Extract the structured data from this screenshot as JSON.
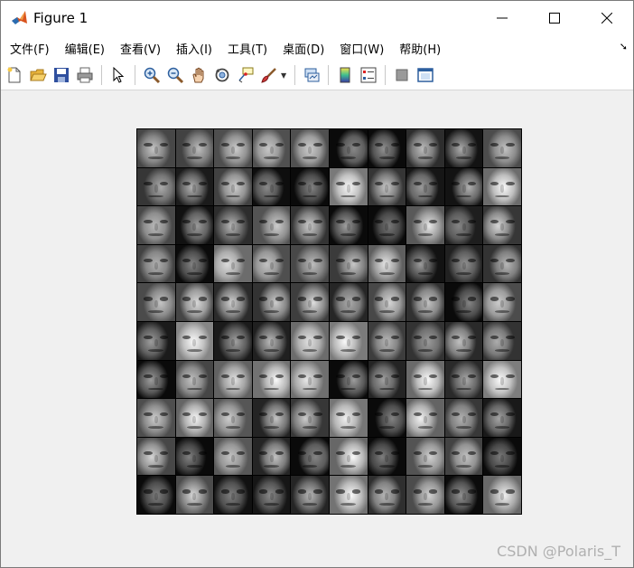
{
  "window": {
    "title": "Figure 1",
    "controls": [
      "minimize",
      "maximize",
      "close"
    ]
  },
  "menubar": {
    "items": [
      {
        "id": "file",
        "label": "文件(F)"
      },
      {
        "id": "edit",
        "label": "编辑(E)"
      },
      {
        "id": "view",
        "label": "查看(V)"
      },
      {
        "id": "insert",
        "label": "插入(I)"
      },
      {
        "id": "tools",
        "label": "工具(T)"
      },
      {
        "id": "desktop",
        "label": "桌面(D)"
      },
      {
        "id": "window",
        "label": "窗口(W)"
      },
      {
        "id": "help",
        "label": "帮助(H)"
      }
    ]
  },
  "toolbar": {
    "buttons": [
      {
        "icon": "new-figure-icon"
      },
      {
        "icon": "open-file-icon"
      },
      {
        "icon": "save-icon"
      },
      {
        "icon": "print-icon"
      },
      {
        "icon": "edit-plot-pointer-icon"
      },
      {
        "icon": "zoom-in-icon"
      },
      {
        "icon": "zoom-out-icon"
      },
      {
        "icon": "pan-hand-icon"
      },
      {
        "icon": "rotate-3d-icon"
      },
      {
        "icon": "data-cursor-icon"
      },
      {
        "icon": "brush-icon"
      },
      {
        "icon": "link-plot-icon"
      },
      {
        "icon": "colorbar-icon"
      },
      {
        "icon": "legend-icon"
      },
      {
        "icon": "hide-plot-tools-icon"
      },
      {
        "icon": "show-plot-tools-icon"
      }
    ]
  },
  "figure": {
    "grid_rows": 10,
    "grid_cols": 10,
    "content": "grayscale face image montage"
  },
  "watermark": "CSDN @Polaris_T",
  "colors": {
    "window_bg": "#f0f0f0",
    "titlebar_bg": "#ffffff",
    "grid_border": "#000000"
  }
}
